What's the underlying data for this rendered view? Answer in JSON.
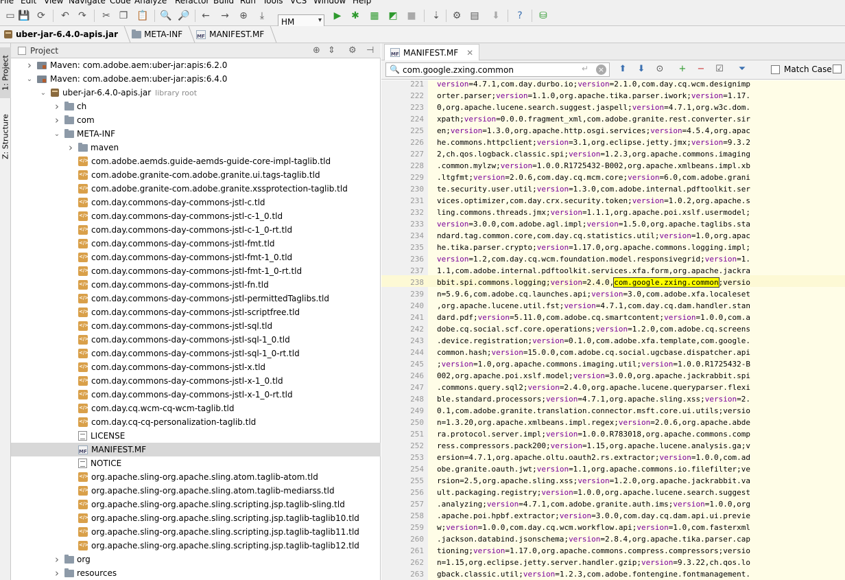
{
  "menu": [
    "File",
    "Edit",
    "View",
    "Navigate",
    "Code",
    "Analyze",
    "Refactor",
    "Build",
    "Run",
    "Tools",
    "VCS",
    "Window",
    "Help"
  ],
  "toolbar": {
    "run_config": "HM"
  },
  "breadcrumb": [
    "uber-jar-6.4.0-apis.jar",
    "META-INF",
    "MANIFEST.MF"
  ],
  "side_tabs": {
    "project": "1: Project",
    "structure": "Z: Structure"
  },
  "project": {
    "title": "Project",
    "rows": [
      {
        "label": "Maven: com.adobe.aem:uber-jar:apis:6.2.0",
        "indent": 0,
        "arrow": "right",
        "icon": "maven"
      },
      {
        "label": "Maven: com.adobe.aem:uber-jar:apis:6.4.0",
        "indent": 0,
        "arrow": "down",
        "icon": "maven"
      },
      {
        "label": "uber-jar-6.4.0-apis.jar",
        "extra": "library root",
        "indent": 1,
        "arrow": "down",
        "icon": "jar"
      },
      {
        "label": "ch",
        "indent": 2,
        "arrow": "right",
        "icon": "folder"
      },
      {
        "label": "com",
        "indent": 2,
        "arrow": "right",
        "icon": "folder"
      },
      {
        "label": "META-INF",
        "indent": 2,
        "arrow": "down",
        "icon": "folder"
      },
      {
        "label": "maven",
        "indent": 3,
        "arrow": "right",
        "icon": "folder"
      },
      {
        "label": "com.adobe.aemds.guide-aemds-guide-core-impl-taglib.tld",
        "indent": 3,
        "icon": "tld"
      },
      {
        "label": "com.adobe.granite-com.adobe.granite.ui.tags-taglib.tld",
        "indent": 3,
        "icon": "tld"
      },
      {
        "label": "com.adobe.granite-com.adobe.granite.xssprotection-taglib.tld",
        "indent": 3,
        "icon": "tld"
      },
      {
        "label": "com.day.commons-day-commons-jstl-c.tld",
        "indent": 3,
        "icon": "tld"
      },
      {
        "label": "com.day.commons-day-commons-jstl-c-1_0.tld",
        "indent": 3,
        "icon": "tld"
      },
      {
        "label": "com.day.commons-day-commons-jstl-c-1_0-rt.tld",
        "indent": 3,
        "icon": "tld"
      },
      {
        "label": "com.day.commons-day-commons-jstl-fmt.tld",
        "indent": 3,
        "icon": "tld"
      },
      {
        "label": "com.day.commons-day-commons-jstl-fmt-1_0.tld",
        "indent": 3,
        "icon": "tld"
      },
      {
        "label": "com.day.commons-day-commons-jstl-fmt-1_0-rt.tld",
        "indent": 3,
        "icon": "tld"
      },
      {
        "label": "com.day.commons-day-commons-jstl-fn.tld",
        "indent": 3,
        "icon": "tld"
      },
      {
        "label": "com.day.commons-day-commons-jstl-permittedTaglibs.tld",
        "indent": 3,
        "icon": "tld"
      },
      {
        "label": "com.day.commons-day-commons-jstl-scriptfree.tld",
        "indent": 3,
        "icon": "tld"
      },
      {
        "label": "com.day.commons-day-commons-jstl-sql.tld",
        "indent": 3,
        "icon": "tld"
      },
      {
        "label": "com.day.commons-day-commons-jstl-sql-1_0.tld",
        "indent": 3,
        "icon": "tld"
      },
      {
        "label": "com.day.commons-day-commons-jstl-sql-1_0-rt.tld",
        "indent": 3,
        "icon": "tld"
      },
      {
        "label": "com.day.commons-day-commons-jstl-x.tld",
        "indent": 3,
        "icon": "tld"
      },
      {
        "label": "com.day.commons-day-commons-jstl-x-1_0.tld",
        "indent": 3,
        "icon": "tld"
      },
      {
        "label": "com.day.commons-day-commons-jstl-x-1_0-rt.tld",
        "indent": 3,
        "icon": "tld"
      },
      {
        "label": "com.day.cq.wcm-cq-wcm-taglib.tld",
        "indent": 3,
        "icon": "tld"
      },
      {
        "label": "com.day.cq-cq-personalization-taglib.tld",
        "indent": 3,
        "icon": "tld"
      },
      {
        "label": "LICENSE",
        "indent": 3,
        "icon": "text"
      },
      {
        "label": "MANIFEST.MF",
        "indent": 3,
        "icon": "mf",
        "selected": true
      },
      {
        "label": "NOTICE",
        "indent": 3,
        "icon": "text"
      },
      {
        "label": "org.apache.sling-org.apache.sling.atom.taglib-atom.tld",
        "indent": 3,
        "icon": "tld"
      },
      {
        "label": "org.apache.sling-org.apache.sling.atom.taglib-mediarss.tld",
        "indent": 3,
        "icon": "tld"
      },
      {
        "label": "org.apache.sling-org.apache.sling.scripting.jsp.taglib-sling.tld",
        "indent": 3,
        "icon": "tld"
      },
      {
        "label": "org.apache.sling-org.apache.sling.scripting.jsp.taglib-taglib10.tld",
        "indent": 3,
        "icon": "tld"
      },
      {
        "label": "org.apache.sling-org.apache.sling.scripting.jsp.taglib-taglib11.tld",
        "indent": 3,
        "icon": "tld"
      },
      {
        "label": "org.apache.sling-org.apache.sling.scripting.jsp.taglib-taglib12.tld",
        "indent": 3,
        "icon": "tld"
      },
      {
        "label": "org",
        "indent": 2,
        "arrow": "right",
        "icon": "folder"
      },
      {
        "label": "resources",
        "indent": 2,
        "arrow": "right",
        "icon": "folder"
      }
    ]
  },
  "editor": {
    "tab": "MANIFEST.MF",
    "search": {
      "query": "com.google.zxing.common",
      "match_case": "Match Case"
    },
    "highlight": "com.google.zxing.common",
    "current_line": 238,
    "lines": [
      {
        "n": 221,
        "t": "version=4.7.1,com.day.durbo.io;version=2.1.0,com.day.cq.wcm.designimp"
      },
      {
        "n": 222,
        "t": "orter.parser;version=1.1.0,org.apache.tika.parser.iwork;version=1.17."
      },
      {
        "n": 223,
        "t": "0,org.apache.lucene.search.suggest.jaspell;version=4.7.1,org.w3c.dom."
      },
      {
        "n": 224,
        "t": "xpath;version=0.0.0.fragment_xml,com.adobe.granite.rest.converter.sir"
      },
      {
        "n": 225,
        "t": "en;version=1.3.0,org.apache.http.osgi.services;version=4.5.4,org.apac"
      },
      {
        "n": 226,
        "t": "he.commons.httpclient;version=3.1,org.eclipse.jetty.jmx;version=9.3.2"
      },
      {
        "n": 227,
        "t": "2,ch.qos.logback.classic.spi;version=1.2.3,org.apache.commons.imaging"
      },
      {
        "n": 228,
        "t": ".common.mylzw;version=1.0.0.R1725432-B002,org.apache.xmlbeans.impl.xb"
      },
      {
        "n": 229,
        "t": ".ltgfmt;version=2.0.6,com.day.cq.mcm.core;version=6.0,com.adobe.grani"
      },
      {
        "n": 230,
        "t": "te.security.user.util;version=1.3.0,com.adobe.internal.pdftoolkit.ser"
      },
      {
        "n": 231,
        "t": "vices.optimizer,com.day.crx.security.token;version=1.0.2,org.apache.s"
      },
      {
        "n": 232,
        "t": "ling.commons.threads.jmx;version=1.1.1,org.apache.poi.xslf.usermodel;"
      },
      {
        "n": 233,
        "t": "version=3.0.0,com.adobe.agl.impl;version=1.5.0,org.apache.taglibs.sta"
      },
      {
        "n": 234,
        "t": "ndard.tag.common.core,com.day.cq.statistics.util;version=1.0,org.apac"
      },
      {
        "n": 235,
        "t": "he.tika.parser.crypto;version=1.17.0,org.apache.commons.logging.impl;"
      },
      {
        "n": 236,
        "t": "version=1.2,com.day.cq.wcm.foundation.model.responsivegrid;version=1."
      },
      {
        "n": 237,
        "t": "1.1,com.adobe.internal.pdftoolkit.services.xfa.form,org.apache.jackra"
      },
      {
        "n": 238,
        "t": "bbit.spi.commons.logging;version=2.4.0,com.google.zxing.common;versio"
      },
      {
        "n": 239,
        "t": "n=5.9.6,com.adobe.cq.launches.api;version=3.0,com.adobe.xfa.localeset"
      },
      {
        "n": 240,
        "t": ",org.apache.lucene.util.fst;version=4.7.1,com.day.cq.dam.handler.stan"
      },
      {
        "n": 241,
        "t": "dard.pdf;version=5.11.0,com.adobe.cq.smartcontent;version=1.0.0,com.a"
      },
      {
        "n": 242,
        "t": "dobe.cq.social.scf.core.operations;version=1.2.0,com.adobe.cq.screens"
      },
      {
        "n": 243,
        "t": ".device.registration;version=0.1.0,com.adobe.xfa.template,com.google."
      },
      {
        "n": 244,
        "t": "common.hash;version=15.0.0,com.adobe.cq.social.ugcbase.dispatcher.api"
      },
      {
        "n": 245,
        "t": ";version=1.0,org.apache.commons.imaging.util;version=1.0.0.R1725432-B"
      },
      {
        "n": 246,
        "t": "002,org.apache.poi.xslf.model;version=3.0.0,org.apache.jackrabbit.spi"
      },
      {
        "n": 247,
        "t": ".commons.query.sql2;version=2.4.0,org.apache.lucene.queryparser.flexi"
      },
      {
        "n": 248,
        "t": "ble.standard.processors;version=4.7.1,org.apache.sling.xss;version=2."
      },
      {
        "n": 249,
        "t": "0.1,com.adobe.granite.translation.connector.msft.core.ui.utils;versio"
      },
      {
        "n": 250,
        "t": "n=1.3.20,org.apache.xmlbeans.impl.regex;version=2.0.6,org.apache.abde"
      },
      {
        "n": 251,
        "t": "ra.protocol.server.impl;version=1.0.0.R783018,org.apache.commons.comp"
      },
      {
        "n": 252,
        "t": "ress.compressors.pack200;version=1.15,org.apache.lucene.analysis.ga;v"
      },
      {
        "n": 253,
        "t": "ersion=4.7.1,org.apache.oltu.oauth2.rs.extractor;version=1.0.0,com.ad"
      },
      {
        "n": 254,
        "t": "obe.granite.oauth.jwt;version=1.1,org.apache.commons.io.filefilter;ve"
      },
      {
        "n": 255,
        "t": "rsion=2.5,org.apache.sling.xss;version=1.2.0,org.apache.jackrabbit.va"
      },
      {
        "n": 256,
        "t": "ult.packaging.registry;version=1.0.0,org.apache.lucene.search.suggest"
      },
      {
        "n": 257,
        "t": ".analyzing;version=4.7.1,com.adobe.granite.auth.ims;version=1.0.0,org"
      },
      {
        "n": 258,
        "t": ".apache.poi.hpbf.extractor;version=3.0.0,com.day.cq.dam.api.ui.previe"
      },
      {
        "n": 259,
        "t": "w;version=1.0.0,com.day.cq.wcm.workflow.api;version=1.0,com.fasterxml"
      },
      {
        "n": 260,
        "t": ".jackson.databind.jsonschema;version=2.8.4,org.apache.tika.parser.cap"
      },
      {
        "n": 261,
        "t": "tioning;version=1.17.0,org.apache.commons.compress.compressors;versio"
      },
      {
        "n": 262,
        "t": "n=1.15,org.eclipse.jetty.server.handler.gzip;version=9.3.22,ch.qos.lo"
      },
      {
        "n": 263,
        "t": "gback.classic.util;version=1.2.3,com.adobe.fontengine.fontmanagement."
      }
    ]
  }
}
